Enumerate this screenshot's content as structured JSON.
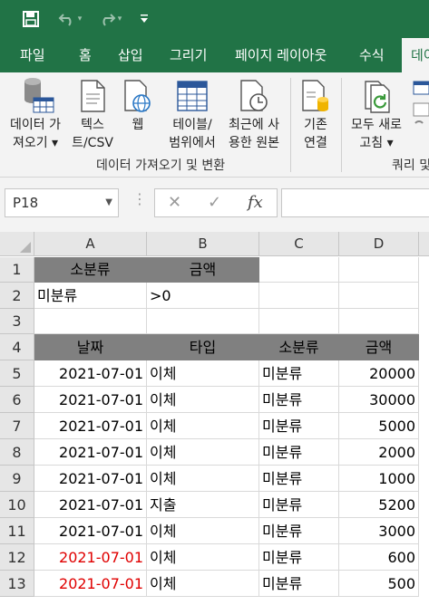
{
  "quick_access": {
    "save_icon": "save-icon",
    "undo_icon": "undo-icon",
    "redo_icon": "redo-icon",
    "customize_icon": "customize-icon"
  },
  "tabs": [
    "파일",
    "홈",
    "삽입",
    "그리기",
    "페이지 레이아웃",
    "수식",
    "데이"
  ],
  "ribbon": {
    "buttons": [
      {
        "line1": "데이터 가",
        "line2": "져오기 ▾",
        "icon": "database-icon"
      },
      {
        "line1": "텍스",
        "line2": "트/CSV",
        "icon": "text-file-icon"
      },
      {
        "line1": "웹",
        "line2": "",
        "icon": "web-icon"
      },
      {
        "line1": "테이블/",
        "line2": "범위에서",
        "icon": "table-icon"
      },
      {
        "line1": "최근에 사",
        "line2": "용한 원본",
        "icon": "recent-sources-icon"
      },
      {
        "line1": "기존",
        "line2": "연결",
        "icon": "existing-connections-icon"
      },
      {
        "line1": "모두 새로",
        "line2": "고침 ▾",
        "icon": "refresh-all-icon"
      }
    ],
    "group1_label": "데이터 가져오기 및 변환",
    "group2_label": "쿼리 및"
  },
  "formula_bar": {
    "name_box": "P18",
    "cancel": "✕",
    "enter": "✓",
    "fx": "fx",
    "formula": ""
  },
  "columns": [
    "A",
    "B",
    "C",
    "D"
  ],
  "rows": [
    "1",
    "2",
    "3",
    "4",
    "5",
    "6",
    "7",
    "8",
    "9",
    "10",
    "11",
    "12",
    "13"
  ],
  "criteria": {
    "header": [
      "소분류",
      "금액"
    ],
    "values": [
      "미분류",
      ">0"
    ]
  },
  "table": {
    "header": [
      "날짜",
      "타입",
      "소분류",
      "금액"
    ],
    "rows": [
      [
        "2021-07-01",
        "이체",
        "미분류",
        "20000"
      ],
      [
        "2021-07-01",
        "이체",
        "미분류",
        "30000"
      ],
      [
        "2021-07-01",
        "이체",
        "미분류",
        "5000"
      ],
      [
        "2021-07-01",
        "이체",
        "미분류",
        "2000"
      ],
      [
        "2021-07-01",
        "이체",
        "미분류",
        "1000"
      ],
      [
        "2021-07-01",
        "지출",
        "미분류",
        "5200"
      ],
      [
        "2021-07-01",
        "이체",
        "미분류",
        "3000"
      ],
      [
        "2021-07-01",
        "이체",
        "미분류",
        "600"
      ],
      [
        "2021-07-01",
        "이체",
        "미분류",
        "500"
      ]
    ]
  },
  "colors": {
    "excel_green": "#217346",
    "header_fill": "#808080",
    "red_text": "#e00000"
  }
}
